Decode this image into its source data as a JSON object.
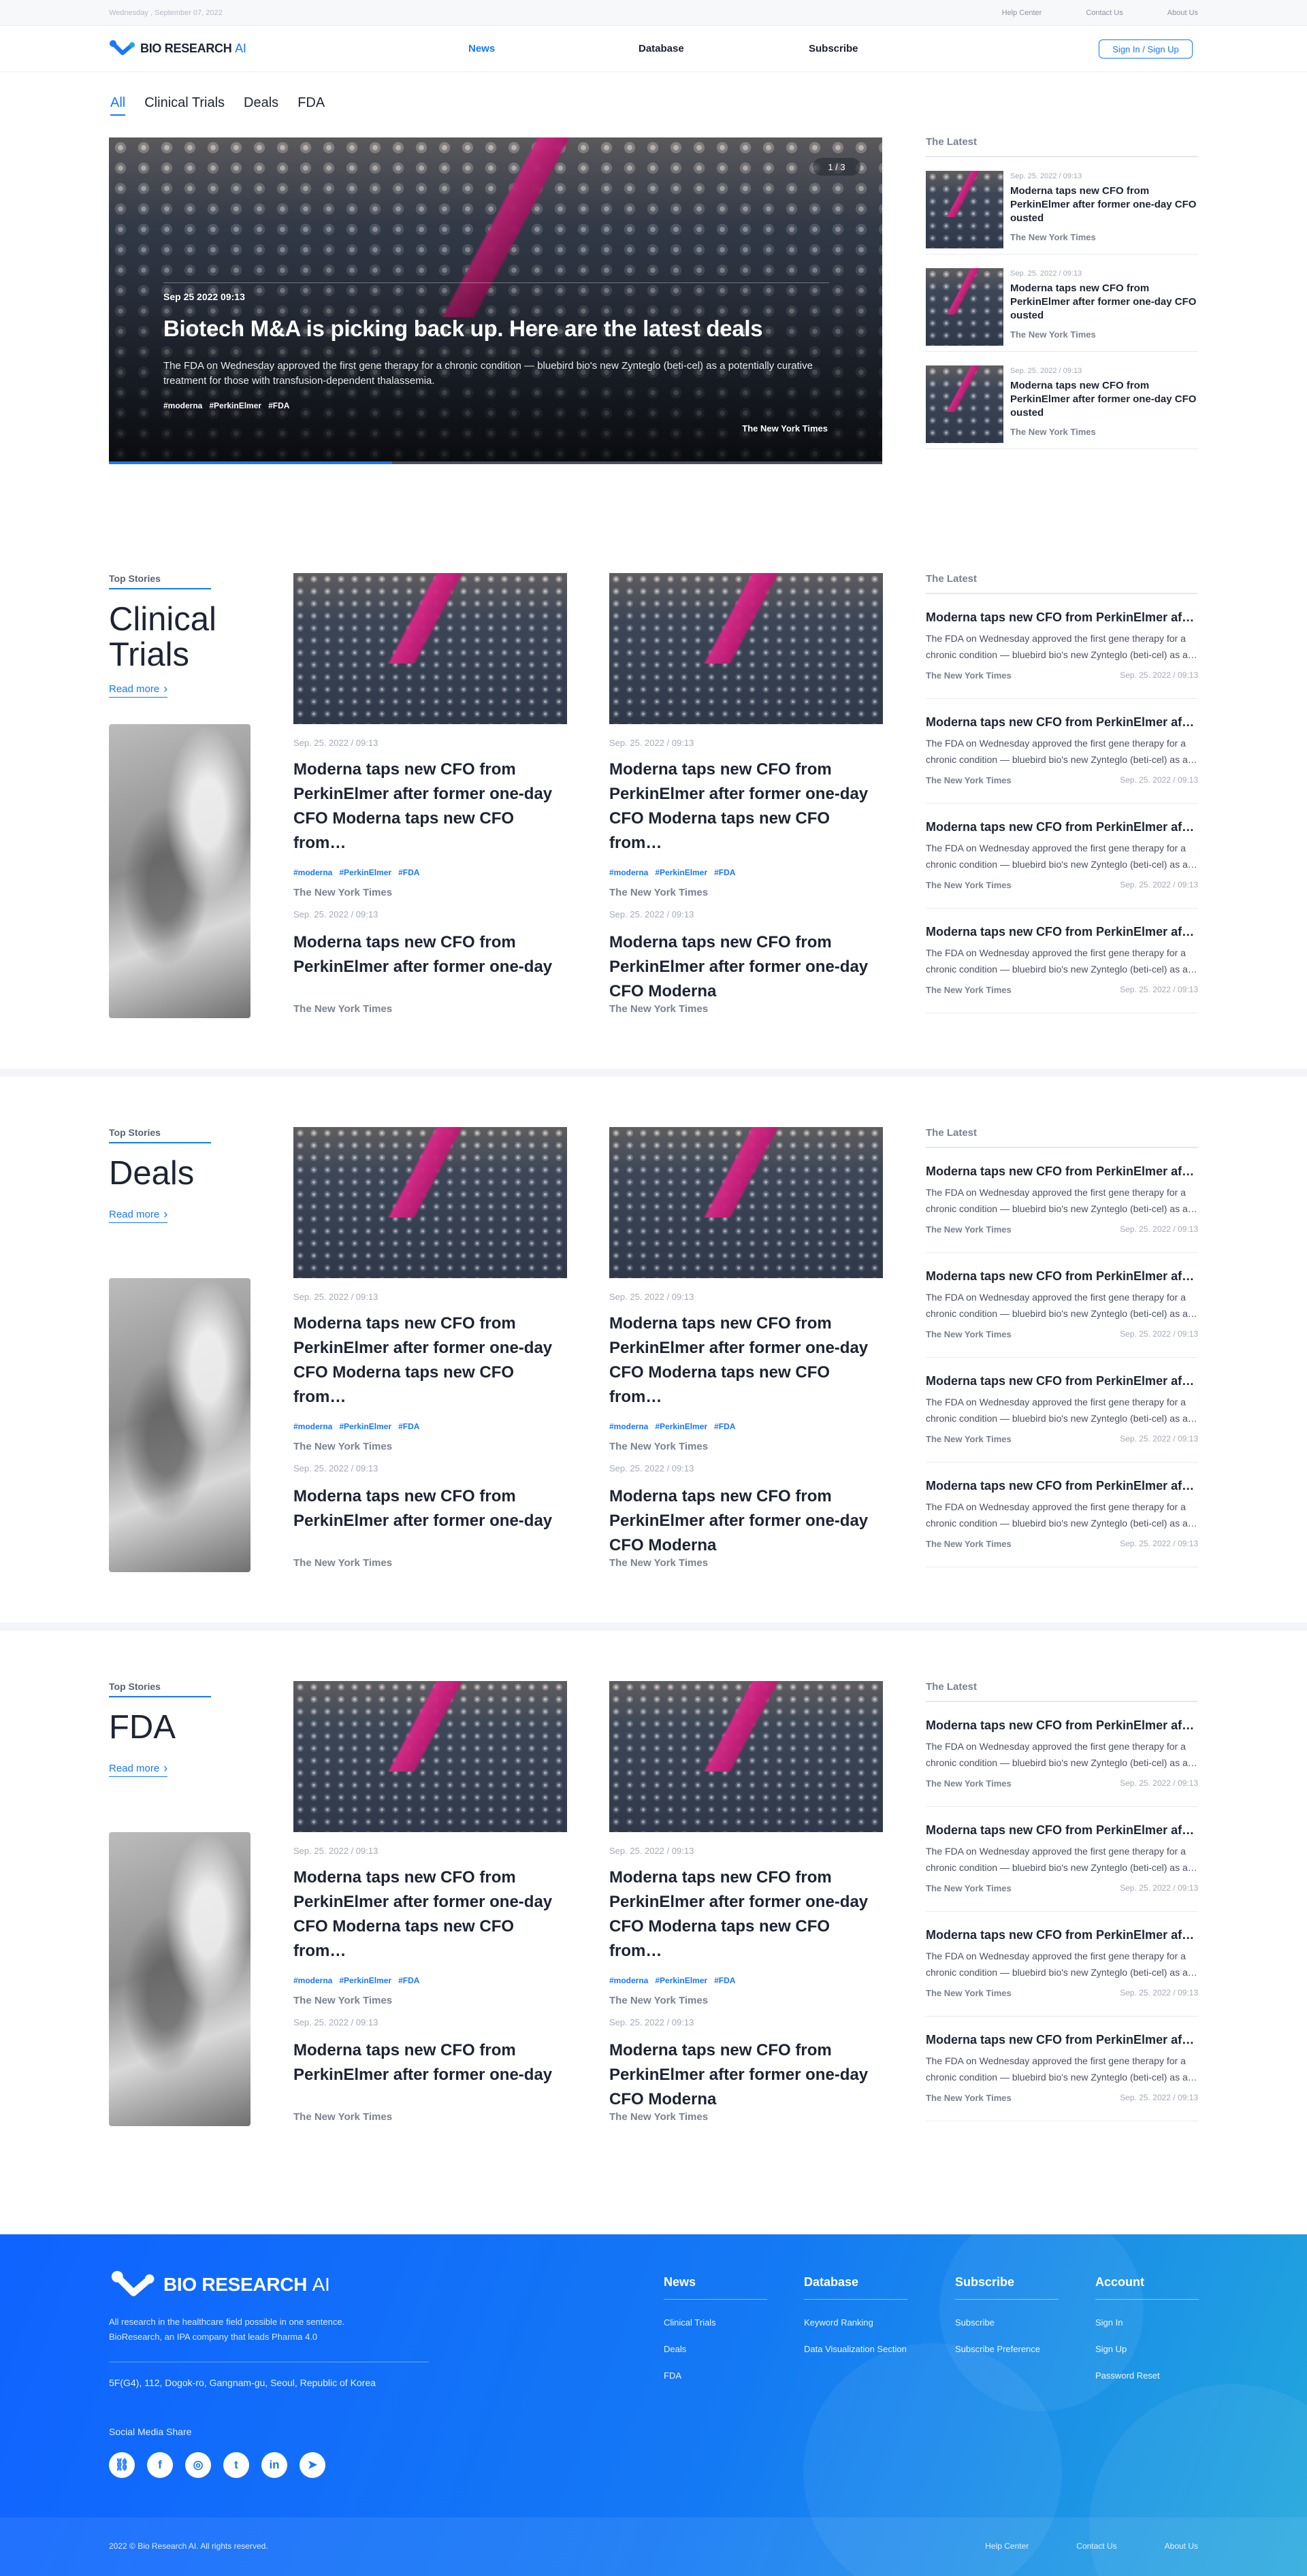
{
  "topbar": {
    "date": "Wednesday , September 07, 2022",
    "links": [
      "Help Center",
      "Contact Us",
      "About Us"
    ]
  },
  "brand": {
    "name": "BIO RESEARCH",
    "ai": "AI",
    "accent": "#1677ff"
  },
  "nav": {
    "items": [
      "News",
      "Database",
      "Subscribe"
    ],
    "active": "News",
    "signin": "Sign In / Sign Up"
  },
  "tabs": [
    "All",
    "Clinical Trials",
    "Deals",
    "FDA"
  ],
  "hero": {
    "counter": "1 / 3",
    "date": "Sep 25 2022 09:13",
    "title": "Biotech M&A is picking back up. Here are the latest deals",
    "desc": "The FDA on Wednesday approved the first gene therapy for a chronic condition — bluebird bio's new Zynteglo (beti-cel) as a potentially curative treatment for those with transfusion-dependent thalassemia.",
    "tags": [
      "#moderna",
      "#PerkinElmer",
      "#FDA"
    ],
    "source": "The New York Times",
    "progress": 0.366
  },
  "latest_top": {
    "title": "The Latest",
    "items": [
      {
        "date": "Sep. 25. 2022 / 09:13",
        "title": "Moderna taps new CFO from PerkinElmer after former one-day CFO ousted",
        "source": "The New York Times"
      },
      {
        "date": "Sep. 25. 2022 / 09:13",
        "title": "Moderna taps new CFO from PerkinElmer after former one-day CFO ousted",
        "source": "The New York Times"
      },
      {
        "date": "Sep. 25. 2022 / 09:13",
        "title": "Moderna taps new CFO from PerkinElmer after former one-day CFO ousted",
        "source": "The New York Times"
      }
    ]
  },
  "sections": [
    {
      "label": "Top Stories",
      "title": "Clinical Trials",
      "readmore": "Read more",
      "cards": [
        {
          "date": "Sep. 25. 2022 / 09:13",
          "title": "Moderna taps new CFO from PerkinElmer after former one-day CFO Moderna taps new CFO from…",
          "tags": [
            "#moderna",
            "#PerkinElmer",
            "#FDA"
          ],
          "source": "The New York Times"
        },
        {
          "date": "Sep. 25. 2022 / 09:13",
          "title": "Moderna taps new CFO from PerkinElmer after former one-day CFO Moderna taps new CFO from…",
          "tags": [
            "#moderna",
            "#PerkinElmer",
            "#FDA"
          ],
          "source": "The New York Times"
        }
      ],
      "small": [
        {
          "date": "Sep. 25. 2022 / 09:13",
          "title": "Moderna taps new CFO from PerkinElmer after former one-day",
          "source": "The New York Times"
        },
        {
          "date": "Sep. 25. 2022 / 09:13",
          "title": "Moderna taps new CFO from PerkinElmer after former one-day CFO Moderna",
          "source": "The New York Times"
        }
      ],
      "latest_title": "The Latest",
      "latest": [
        {
          "title": "Moderna taps new CFO from PerkinElmer after former one-day CFO ousted",
          "desc": "The FDA on Wednesday approved the first gene therapy for a chronic condition — bluebird bio's new Zynteglo (beti-cel) as a potentially curative treatment",
          "source": "The New York Times",
          "date": "Sep. 25. 2022 / 09:13"
        },
        {
          "title": "Moderna taps new CFO from PerkinElmer after former one-day CFO ousted",
          "desc": "The FDA on Wednesday approved the first gene therapy for a chronic condition — bluebird bio's new Zynteglo (beti-cel) as a potentially curative treatment",
          "source": "The New York Times",
          "date": "Sep. 25. 2022 / 09:13"
        },
        {
          "title": "Moderna taps new CFO from PerkinElmer after former one-day CFO ousted",
          "desc": "The FDA on Wednesday approved the first gene therapy for a chronic condition — bluebird bio's new Zynteglo (beti-cel) as a potentially curative treatment",
          "source": "The New York Times",
          "date": "Sep. 25. 2022 / 09:13"
        },
        {
          "title": "Moderna taps new CFO from PerkinElmer after former one-day CFO ousted",
          "desc": "The FDA on Wednesday approved the first gene therapy for a chronic condition — bluebird bio's new Zynteglo (beti-cel) as a potentially curative treatment",
          "source": "The New York Times",
          "date": "Sep. 25. 2022 / 09:13"
        }
      ]
    },
    {
      "label": "Top Stories",
      "title": "Deals",
      "readmore": "Read more",
      "cards": [
        {
          "date": "Sep. 25. 2022 / 09:13",
          "title": "Moderna taps new CFO from PerkinElmer after former one-day CFO Moderna taps new CFO from…",
          "tags": [
            "#moderna",
            "#PerkinElmer",
            "#FDA"
          ],
          "source": "The New York Times"
        },
        {
          "date": "Sep. 25. 2022 / 09:13",
          "title": "Moderna taps new CFO from PerkinElmer after former one-day CFO Moderna taps new CFO from…",
          "tags": [
            "#moderna",
            "#PerkinElmer",
            "#FDA"
          ],
          "source": "The New York Times"
        }
      ],
      "small": [
        {
          "date": "Sep. 25. 2022 / 09:13",
          "title": "Moderna taps new CFO from PerkinElmer after former one-day",
          "source": "The New York Times"
        },
        {
          "date": "Sep. 25. 2022 / 09:13",
          "title": "Moderna taps new CFO from PerkinElmer after former one-day CFO Moderna",
          "source": "The New York Times"
        }
      ],
      "latest_title": "The Latest",
      "latest": [
        {
          "title": "Moderna taps new CFO from PerkinElmer after former one-day CFO ousted",
          "desc": "The FDA on Wednesday approved the first gene therapy for a chronic condition — bluebird bio's new Zynteglo (beti-cel) as a potentially curative treatment",
          "source": "The New York Times",
          "date": "Sep. 25. 2022 / 09:13"
        },
        {
          "title": "Moderna taps new CFO from PerkinElmer after former one-day CFO ousted",
          "desc": "The FDA on Wednesday approved the first gene therapy for a chronic condition — bluebird bio's new Zynteglo (beti-cel) as a potentially curative treatment",
          "source": "The New York Times",
          "date": "Sep. 25. 2022 / 09:13"
        },
        {
          "title": "Moderna taps new CFO from PerkinElmer after former one-day CFO ousted",
          "desc": "The FDA on Wednesday approved the first gene therapy for a chronic condition — bluebird bio's new Zynteglo (beti-cel) as a potentially curative treatment",
          "source": "The New York Times",
          "date": "Sep. 25. 2022 / 09:13"
        },
        {
          "title": "Moderna taps new CFO from PerkinElmer after former one-day CFO ousted",
          "desc": "The FDA on Wednesday approved the first gene therapy for a chronic condition — bluebird bio's new Zynteglo (beti-cel) as a potentially curative treatment",
          "source": "The New York Times",
          "date": "Sep. 25. 2022 / 09:13"
        }
      ]
    },
    {
      "label": "Top Stories",
      "title": "FDA",
      "readmore": "Read more",
      "cards": [
        {
          "date": "Sep. 25. 2022 / 09:13",
          "title": "Moderna taps new CFO from PerkinElmer after former one-day CFO Moderna taps new CFO from…",
          "tags": [
            "#moderna",
            "#PerkinElmer",
            "#FDA"
          ],
          "source": "The New York Times"
        },
        {
          "date": "Sep. 25. 2022 / 09:13",
          "title": "Moderna taps new CFO from PerkinElmer after former one-day CFO Moderna taps new CFO from…",
          "tags": [
            "#moderna",
            "#PerkinElmer",
            "#FDA"
          ],
          "source": "The New York Times"
        }
      ],
      "small": [
        {
          "date": "Sep. 25. 2022 / 09:13",
          "title": "Moderna taps new CFO from PerkinElmer after former one-day",
          "source": "The New York Times"
        },
        {
          "date": "Sep. 25. 2022 / 09:13",
          "title": "Moderna taps new CFO from PerkinElmer after former one-day CFO Moderna",
          "source": "The New York Times"
        }
      ],
      "latest_title": "The Latest",
      "latest": [
        {
          "title": "Moderna taps new CFO from PerkinElmer after former one-day CFO ousted",
          "desc": "The FDA on Wednesday approved the first gene therapy for a chronic condition — bluebird bio's new Zynteglo (beti-cel) as a potentially curative treatment",
          "source": "The New York Times",
          "date": "Sep. 25. 2022 / 09:13"
        },
        {
          "title": "Moderna taps new CFO from PerkinElmer after former one-day CFO ousted",
          "desc": "The FDA on Wednesday approved the first gene therapy for a chronic condition — bluebird bio's new Zynteglo (beti-cel) as a potentially curative treatment",
          "source": "The New York Times",
          "date": "Sep. 25. 2022 / 09:13"
        },
        {
          "title": "Moderna taps new CFO from PerkinElmer after former one-day CFO ousted",
          "desc": "The FDA on Wednesday approved the first gene therapy for a chronic condition — bluebird bio's new Zynteglo (beti-cel) as a potentially curative treatment",
          "source": "The New York Times",
          "date": "Sep. 25. 2022 / 09:13"
        },
        {
          "title": "Moderna taps new CFO from PerkinElmer after former one-day CFO ousted",
          "desc": "The FDA on Wednesday approved the first gene therapy for a chronic condition — bluebird bio's new Zynteglo (beti-cel) as a potentially curative treatment",
          "source": "The New York Times",
          "date": "Sep. 25. 2022 / 09:13"
        }
      ]
    }
  ],
  "footer": {
    "tagline1": "All research in the healthcare field possible in one sentence.",
    "tagline2": "BioResearch, an IPA company that leads Pharma 4.0",
    "address": "5F(G4), 112, Dogok-ro, Gangnam-gu, Seoul, Republic of Korea",
    "social_title": "Social Media Share",
    "social_icons": [
      "link-icon",
      "facebook-icon",
      "instagram-icon",
      "twitter-icon",
      "linkedin-icon",
      "telegram-icon"
    ],
    "columns": [
      {
        "title": "News",
        "links": [
          "Clinical Trials",
          "Deals",
          "FDA"
        ]
      },
      {
        "title": "Database",
        "links": [
          "Keyword Ranking",
          "Data Visualization Section"
        ]
      },
      {
        "title": "Subscribe",
        "links": [
          "Subscribe",
          "Subscribe Preference"
        ]
      },
      {
        "title": "Account",
        "links": [
          "Sign In",
          "Sign Up",
          "Password Reset"
        ]
      }
    ],
    "copyright": "2022 © Bio Research AI. All rights reserved.",
    "bottom_links": [
      "Help Center",
      "Contact Us",
      "About Us"
    ]
  }
}
